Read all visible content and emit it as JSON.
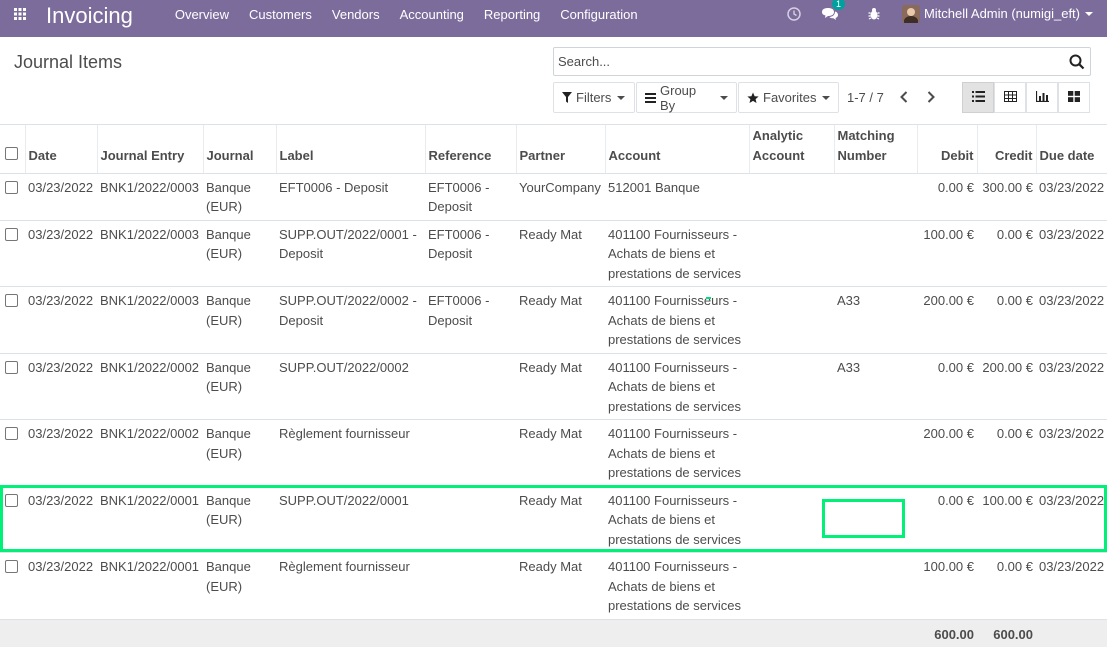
{
  "navbar": {
    "app_title": "Invoicing",
    "menu": [
      "Overview",
      "Customers",
      "Vendors",
      "Accounting",
      "Reporting",
      "Configuration"
    ],
    "messages_badge": "1",
    "user_name": "Mitchell Admin (numigi_eft)"
  },
  "control_panel": {
    "breadcrumb": "Journal Items",
    "search_placeholder": "Search...",
    "filters_label": "Filters",
    "group_by_label": "Group By",
    "favorites_label": "Favorites",
    "pager": "1-7 / 7"
  },
  "table": {
    "columns": [
      "Date",
      "Journal Entry",
      "Journal",
      "Label",
      "Reference",
      "Partner",
      "Account",
      "Analytic Account",
      "Matching Number",
      "Debit",
      "Credit",
      "Due date"
    ],
    "rows": [
      {
        "date": "03/23/2022",
        "entry": "BNK1/2022/0003",
        "journal": "Banque (EUR)",
        "label": "EFT0006 - Deposit",
        "reference": "EFT0006 - Deposit",
        "partner": "YourCompany",
        "account": "512001 Banque",
        "analytic": "",
        "matching": "",
        "debit": "0.00 €",
        "credit": "300.00 €",
        "due": "03/23/2022"
      },
      {
        "date": "03/23/2022",
        "entry": "BNK1/2022/0003",
        "journal": "Banque (EUR)",
        "label": "SUPP.OUT/2022/0001 - Deposit",
        "reference": "EFT0006 - Deposit",
        "partner": "Ready Mat",
        "account": "401100 Fournisseurs - Achats de biens et prestations de services",
        "analytic": "",
        "matching": "",
        "debit": "100.00 €",
        "credit": "0.00 €",
        "due": "03/23/2022"
      },
      {
        "date": "03/23/2022",
        "entry": "BNK1/2022/0003",
        "journal": "Banque (EUR)",
        "label": "SUPP.OUT/2022/0002 - Deposit",
        "reference": "EFT0006 - Deposit",
        "partner": "Ready Mat",
        "account": "401100 Fournisseurs - Achats de biens et prestations de services",
        "analytic": "",
        "matching": "A33",
        "debit": "200.00 €",
        "credit": "0.00 €",
        "due": "03/23/2022"
      },
      {
        "date": "03/23/2022",
        "entry": "BNK1/2022/0002",
        "journal": "Banque (EUR)",
        "label": "SUPP.OUT/2022/0002",
        "reference": "",
        "partner": "Ready Mat",
        "account": "401100 Fournisseurs - Achats de biens et prestations de services",
        "analytic": "",
        "matching": "A33",
        "debit": "0.00 €",
        "credit": "200.00 €",
        "due": "03/23/2022"
      },
      {
        "date": "03/23/2022",
        "entry": "BNK1/2022/0002",
        "journal": "Banque (EUR)",
        "label": "Règlement fournisseur",
        "reference": "",
        "partner": "Ready Mat",
        "account": "401100 Fournisseurs - Achats de biens et prestations de services",
        "analytic": "",
        "matching": "",
        "debit": "200.00 €",
        "credit": "0.00 €",
        "due": "03/23/2022"
      },
      {
        "date": "03/23/2022",
        "entry": "BNK1/2022/0001",
        "journal": "Banque (EUR)",
        "label": "SUPP.OUT/2022/0001",
        "reference": "",
        "partner": "Ready Mat",
        "account": "401100 Fournisseurs - Achats de biens et prestations de services",
        "analytic": "",
        "matching": "",
        "debit": "0.00 €",
        "credit": "100.00 €",
        "due": "03/23/2022"
      },
      {
        "date": "03/23/2022",
        "entry": "BNK1/2022/0001",
        "journal": "Banque (EUR)",
        "label": "Règlement fournisseur",
        "reference": "",
        "partner": "Ready Mat",
        "account": "401100 Fournisseurs - Achats de biens et prestations de services",
        "analytic": "",
        "matching": "",
        "debit": "100.00 €",
        "credit": "0.00 €",
        "due": "03/23/2022"
      }
    ],
    "totals": {
      "debit": "600.00",
      "credit": "600.00"
    }
  },
  "colors": {
    "navbar": "#7c6c9c",
    "highlight": "#00f078",
    "badge": "#00a09d"
  }
}
